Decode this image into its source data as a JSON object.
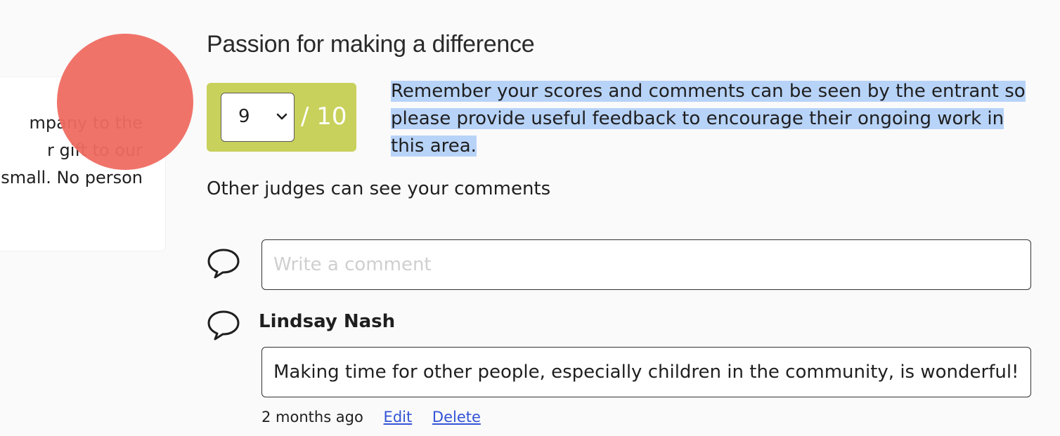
{
  "left_card": {
    "text_lines": [
      "mpany to the",
      "r gift to our",
      "small. No person"
    ]
  },
  "section": {
    "title": "Passion for making a difference"
  },
  "score": {
    "selected": "9",
    "max_label": "/ 10",
    "accent_color": "#c8d15b"
  },
  "info": {
    "text": "Remember your scores and comments can be seen by the entrant so please provide useful feedback to encourage their ongoing work in this area.",
    "highlight_color": "#b8d3f8"
  },
  "judges_note": "Other judges can see your comments",
  "new_comment": {
    "placeholder": "Write a comment",
    "value": ""
  },
  "comment": {
    "author": "Lindsay Nash",
    "body": "Making time for other people, especially children in the community, is wonderful!",
    "timestamp": "2 months ago",
    "edit_label": "Edit",
    "delete_label": "Delete"
  },
  "icons": {
    "comment": "speech-bubble-icon",
    "dropdown": "chevron-down-icon"
  },
  "cursor": {
    "color": "#ef6b62"
  }
}
